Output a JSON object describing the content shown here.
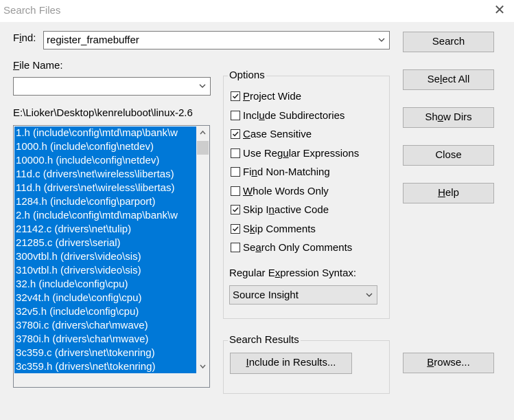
{
  "window": {
    "title": "Search Files",
    "close_glyph": "✕"
  },
  "find": {
    "label_pre": "F",
    "label_u": "i",
    "label_post": "nd:",
    "value": "register_framebuffer"
  },
  "file_name": {
    "label_u": "F",
    "label_post": "ile Name:",
    "value": ""
  },
  "path": "E:\\Lioker\\Desktop\\kenreluboot\\linux-2.6",
  "files": [
    "1.h (include\\config\\mtd\\map\\bank\\w",
    "1000.h (include\\config\\netdev)",
    "10000.h (include\\config\\netdev)",
    "11d.c (drivers\\net\\wireless\\libertas)",
    "11d.h (drivers\\net\\wireless\\libertas)",
    "1284.h (include\\config\\parport)",
    "2.h (include\\config\\mtd\\map\\bank\\w",
    "21142.c (drivers\\net\\tulip)",
    "21285.c (drivers\\serial)",
    "300vtbl.h (drivers\\video\\sis)",
    "310vtbl.h (drivers\\video\\sis)",
    "32.h (include\\config\\cpu)",
    "32v4t.h (include\\config\\cpu)",
    "32v5.h (include\\config\\cpu)",
    "3780i.c (drivers\\char\\mwave)",
    "3780i.h (drivers\\char\\mwave)",
    "3c359.c (drivers\\net\\tokenring)",
    "3c359.h (drivers\\net\\tokenring)"
  ],
  "options": {
    "title": "Options",
    "items": [
      {
        "pre": "",
        "u": "P",
        "post": "roject Wide",
        "checked": true
      },
      {
        "pre": "Incl",
        "u": "u",
        "post": "de Subdirectories",
        "checked": false
      },
      {
        "pre": "",
        "u": "C",
        "post": "ase Sensitive",
        "checked": true
      },
      {
        "pre": "Use Reg",
        "u": "u",
        "post": "lar Expressions",
        "checked": false
      },
      {
        "pre": "Fi",
        "u": "n",
        "post": "d Non-Matching",
        "checked": false
      },
      {
        "pre": "",
        "u": "W",
        "post": "hole Words Only",
        "checked": false
      },
      {
        "pre": "Skip I",
        "u": "n",
        "post": "active Code",
        "checked": true
      },
      {
        "pre": "S",
        "u": "k",
        "post": "ip Comments",
        "checked": true
      },
      {
        "pre": "Se",
        "u": "a",
        "post": "rch Only Comments",
        "checked": false
      }
    ],
    "regex_label_pre": "Regular E",
    "regex_label_u": "x",
    "regex_label_post": "pression Syntax:",
    "regex_value": "Source Insight"
  },
  "results": {
    "title": "Search Results",
    "include_pre": "",
    "include_u": "I",
    "include_post": "nclude in Results..."
  },
  "buttons": {
    "search": {
      "pre": "Search",
      "u": "",
      "post": ""
    },
    "select_all": {
      "pre": "Se",
      "u": "l",
      "post": "ect All"
    },
    "show_dirs": {
      "pre": "Sh",
      "u": "o",
      "post": "w Dirs"
    },
    "close": {
      "pre": "Close",
      "u": "",
      "post": ""
    },
    "help": {
      "pre": "",
      "u": "H",
      "post": "elp"
    },
    "browse": {
      "pre": "",
      "u": "B",
      "post": "rowse..."
    }
  }
}
